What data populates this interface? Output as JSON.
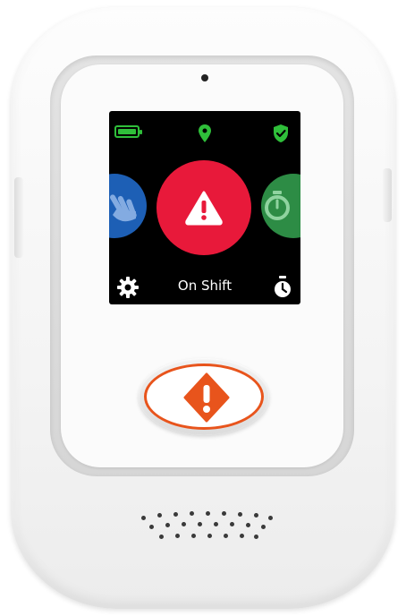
{
  "screen": {
    "status_bar": {
      "battery_icon": "battery-full-icon",
      "location_icon": "location-pin-icon",
      "shield_icon": "shield-check-icon"
    },
    "carousel": {
      "left_icon": "hand-wave-icon",
      "center_icon": "warning-icon",
      "right_icon": "stopwatch-icon"
    },
    "bottom_bar": {
      "settings_icon": "gear-icon",
      "status_label": "On Shift",
      "timer_icon": "stopwatch-icon"
    }
  },
  "panic_button": {
    "icon": "diamond-alert-icon"
  },
  "colors": {
    "battery": "#2fbf3a",
    "sos_red": "#e8193a",
    "left_blue": "#1d5fb5",
    "right_green": "#2d8c45",
    "panic_orange": "#e8541c"
  }
}
